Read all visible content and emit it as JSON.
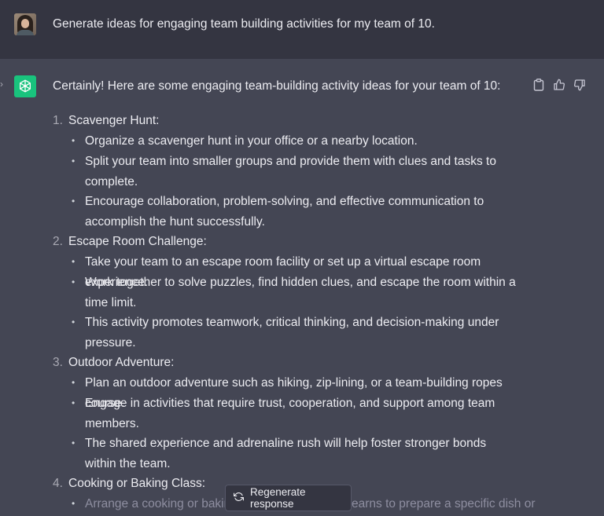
{
  "user": {
    "avatar_icon": "user-avatar-photo",
    "message": "Generate ideas for engaging team building activities for my team of 10."
  },
  "assistant": {
    "logo_icon": "openai-logo-icon",
    "intro": "Certainly! Here are some engaging team-building activity ideas for your team of 10:",
    "actions": {
      "copy_icon": "clipboard-icon",
      "like_icon": "thumbs-up-icon",
      "dislike_icon": "thumbs-down-icon"
    },
    "items": [
      {
        "num": "1.",
        "title": "Scavenger Hunt:",
        "bullets": [
          "Organize a scavenger hunt in your office or a nearby location.",
          "Split your team into smaller groups and provide them with clues and tasks to complete.",
          "Encourage collaboration, problem-solving, and effective communication to accomplish the hunt successfully."
        ]
      },
      {
        "num": "2.",
        "title": "Escape Room Challenge:",
        "bullets": [
          "Take your team to an escape room facility or set up a virtual escape room experience.",
          "Work together to solve puzzles, find hidden clues, and escape the room within a time limit.",
          "This activity promotes teamwork, critical thinking, and decision-making under pressure."
        ]
      },
      {
        "num": "3.",
        "title": "Outdoor Adventure:",
        "bullets": [
          "Plan an outdoor adventure such as hiking, zip-lining, or a team-building ropes course.",
          "Engage in activities that require trust, cooperation, and support among team members.",
          "The shared experience and adrenaline rush will help foster stronger bonds within the team."
        ]
      },
      {
        "num": "4.",
        "title": "Cooking or Baking Class:",
        "bullets_partial": {
          "left": "Arrange a cooking or bakin",
          "right": "earns to prepare a specific dish or"
        }
      }
    ]
  },
  "regenerate": {
    "icon": "refresh-icon",
    "label": "Regenerate response"
  }
}
